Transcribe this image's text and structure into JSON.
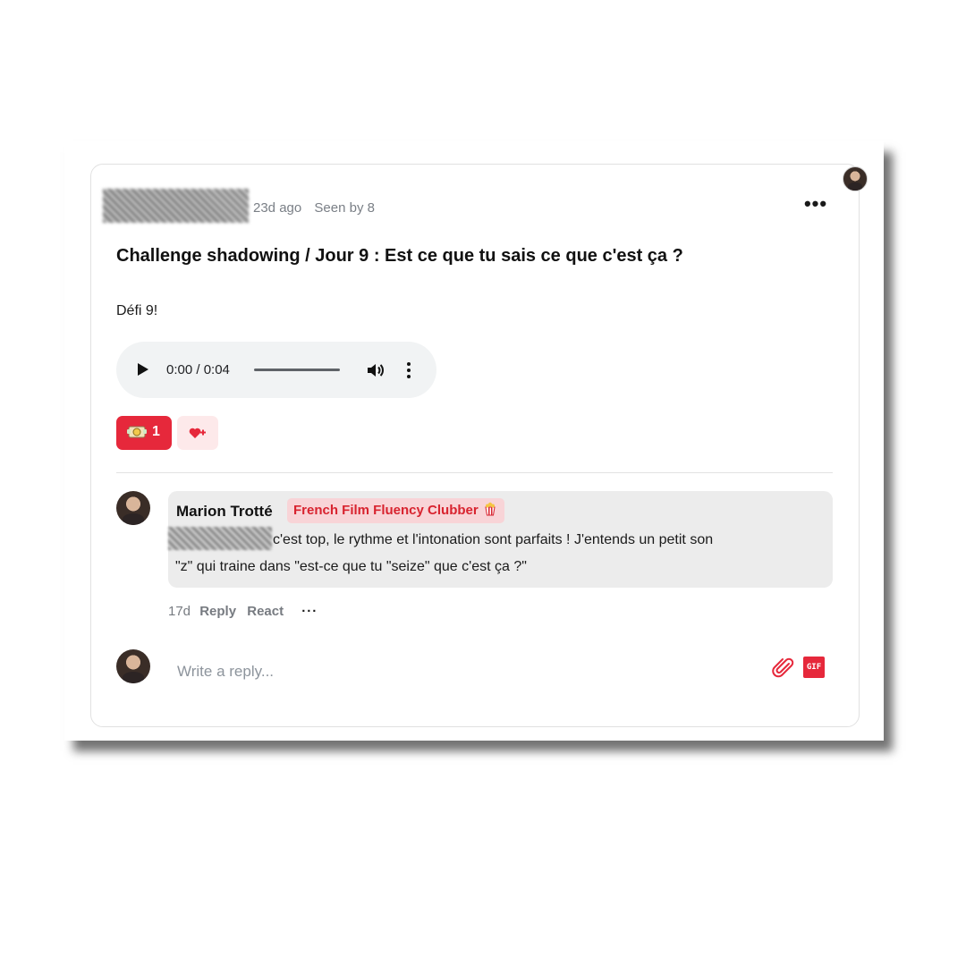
{
  "post": {
    "time_ago": "23d ago",
    "seen_by": "Seen by 8",
    "title": "Challenge shadowing / Jour 9 : Est ce que tu sais ce que c'est ça ?",
    "body": "Défi 9!",
    "more_icon": "more-horizontal-icon"
  },
  "audio": {
    "time": "0:00 / 0:04",
    "progress": 0
  },
  "reactions": {
    "count": "1",
    "emoji_icon": "money-face-icon",
    "add_icon": "heart-plus-icon"
  },
  "comment": {
    "author": "Marion Trotté",
    "badge": "French Film Fluency Clubber",
    "badge_icon": "popcorn-icon",
    "line1": "c'est top, le rythme et l'intonation sont parfaits ! J'entends un petit son",
    "line2": "\"z\" qui traine dans \"est-ce que tu \"seize\" que c'est ça ?\"",
    "age": "17d",
    "reply_label": "Reply",
    "react_label": "React",
    "more_label": "···"
  },
  "reply_box": {
    "placeholder": "Write a reply...",
    "gif_label": "GIF"
  },
  "colors": {
    "accent": "#e6283b",
    "badge_bg": "#f8d4d7",
    "bubble_bg": "#ececec",
    "audio_bg": "#f1f3f4"
  }
}
